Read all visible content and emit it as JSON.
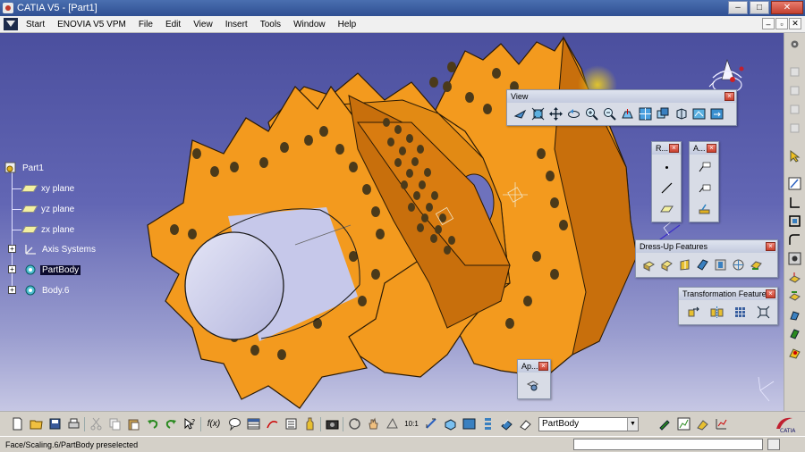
{
  "window": {
    "title": "CATIA V5 - [Part1]",
    "minimize": "–",
    "maximize": "□",
    "close": "✕"
  },
  "menu": {
    "items": [
      {
        "label": "Start"
      },
      {
        "label": "ENOVIA V5 VPM"
      },
      {
        "label": "File"
      },
      {
        "label": "Edit"
      },
      {
        "label": "View"
      },
      {
        "label": "Insert"
      },
      {
        "label": "Tools"
      },
      {
        "label": "Window"
      },
      {
        "label": "Help"
      }
    ],
    "doc_minimize": "–",
    "doc_restore": "▫",
    "doc_close": "✕"
  },
  "tree": {
    "root": "Part1",
    "items": [
      {
        "label": "xy plane"
      },
      {
        "label": "yz plane"
      },
      {
        "label": "zx plane"
      },
      {
        "label": "Axis Systems"
      },
      {
        "label": "PartBody"
      },
      {
        "label": "Body.6"
      }
    ],
    "expand_symbol": "+"
  },
  "toolbars": {
    "view": {
      "title": "View",
      "close": "×"
    },
    "r": {
      "title": "R...",
      "close": "×"
    },
    "a": {
      "title": "A...",
      "close": "×"
    },
    "dressup": {
      "title": "Dress-Up Features",
      "close": "×"
    },
    "transformation": {
      "title": "Transformation Features",
      "close": "×"
    },
    "ap": {
      "title": "Ap...",
      "close": "×"
    }
  },
  "bottom": {
    "current_body": "PartBody",
    "dropdown_arrow": "▼",
    "fx_label": "f(x)",
    "scale_label": "10:1",
    "catia_label": "CATIA"
  },
  "status": {
    "text": "Face/Scaling.6/PartBody preselected"
  },
  "colors": {
    "part": "#f39a1e",
    "part_dark": "#c86f0c",
    "cylinder": "#d5d6f0",
    "background_top": "#4b4f9e"
  }
}
